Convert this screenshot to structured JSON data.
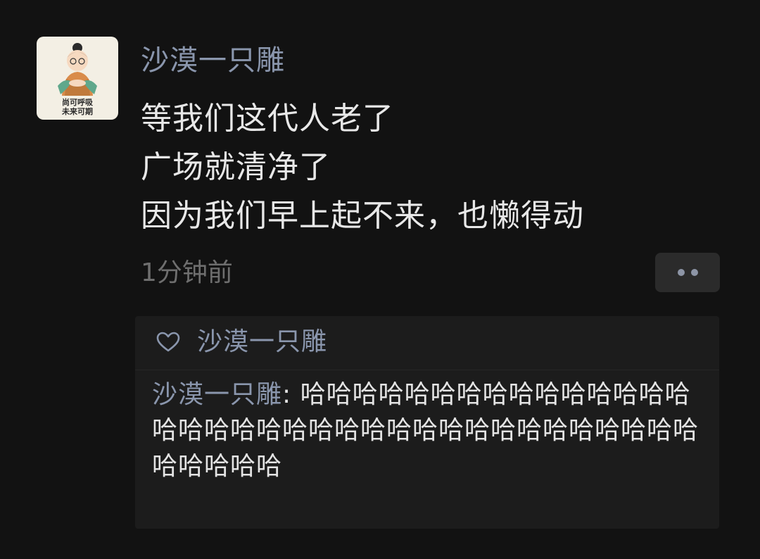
{
  "post": {
    "avatar": {
      "caption_line1": "尚可呼吸",
      "caption_line2": "未来可期"
    },
    "author": "沙漠一只雕",
    "lines": [
      "等我们这代人老了",
      "广场就清净了",
      "因为我们早上起不来，也懒得动"
    ],
    "timestamp": "1分钟前",
    "more_icon": "more-dots-icon"
  },
  "interactions": {
    "like_icon": "heart-icon",
    "likes": "沙漠一只雕",
    "comments": [
      {
        "author": "沙漠一只雕",
        "separator": ": ",
        "text": "哈哈哈哈哈哈哈哈哈哈哈哈哈哈哈哈哈哈哈哈哈哈哈哈哈哈哈哈哈哈哈哈哈哈哈哈哈哈哈哈哈"
      }
    ]
  },
  "colors": {
    "background": "#121212",
    "name_blue": "#8a96ad",
    "text": "#e8e8e8",
    "timestamp": "#6e6e6e",
    "panel": "#1c1c1c"
  }
}
